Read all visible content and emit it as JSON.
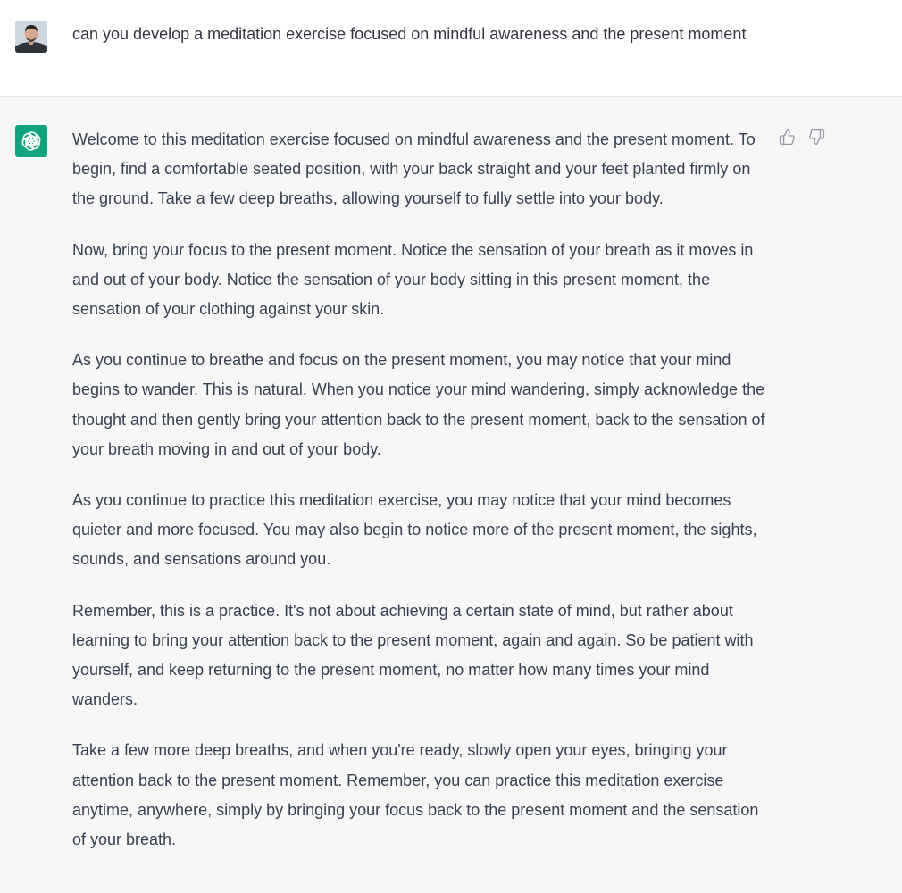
{
  "user_message": {
    "text": "can you develop a meditation exercise focused on mindful awareness and the present moment"
  },
  "assistant_message": {
    "paragraphs": [
      "Welcome to this meditation exercise focused on mindful awareness and the present moment. To begin, find a comfortable seated position, with your back straight and your feet planted firmly on the ground. Take a few deep breaths, allowing yourself to fully settle into your body.",
      "Now, bring your focus to the present moment. Notice the sensation of your breath as it moves in and out of your body. Notice the sensation of your body sitting in this present moment, the sensation of your clothing against your skin.",
      "As you continue to breathe and focus on the present moment, you may notice that your mind begins to wander. This is natural. When you notice your mind wandering, simply acknowledge the thought and then gently bring your attention back to the present moment, back to the sensation of your breath moving in and out of your body.",
      "As you continue to practice this meditation exercise, you may notice that your mind becomes quieter and more focused. You may also begin to notice more of the present moment, the sights, sounds, and sensations around you.",
      "Remember, this is a practice. It's not about achieving a certain state of mind, but rather about learning to bring your attention back to the present moment, again and again. So be patient with yourself, and keep returning to the present moment, no matter how many times your mind wanders.",
      "Take a few more deep breaths, and when you're ready, slowly open your eyes, bringing your attention back to the present moment. Remember, you can practice this meditation exercise anytime, anywhere, simply by bringing your focus back to the present moment and the sensation of your breath."
    ]
  },
  "icons": {
    "user_avatar": "user-avatar-photo",
    "assistant_avatar": "openai-logo-icon",
    "thumbs_up": "thumbs-up-icon",
    "thumbs_down": "thumbs-down-icon"
  },
  "colors": {
    "brand_green": "#10a37f",
    "user_bg": "#ffffff",
    "assistant_bg": "#f7f7f8",
    "text": "#374151"
  }
}
